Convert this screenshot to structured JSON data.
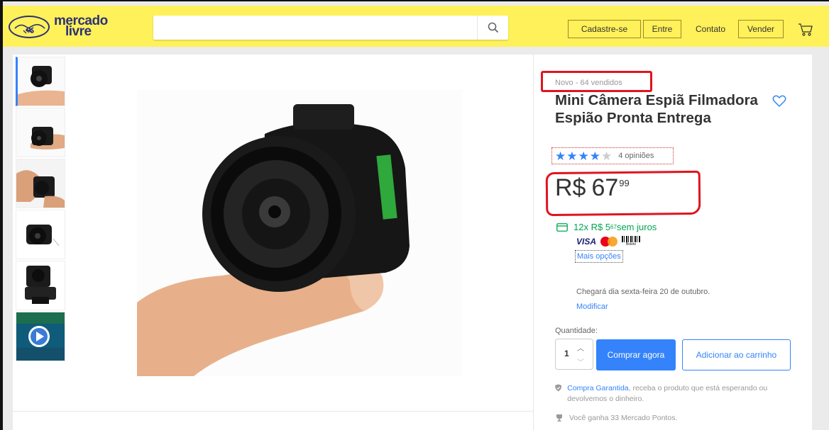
{
  "header": {
    "logo_line1": "mercado",
    "logo_line2": "livre",
    "search": {
      "value": "",
      "placeholder": ""
    },
    "nav": {
      "signup": "Cadastre-se",
      "login": "Entre",
      "contact": "Contato",
      "sell": "Vender"
    }
  },
  "product": {
    "condition": "Novo  -  64 vendidos",
    "title": "Mini Câmera Espiã Filmadora Espião Pronta Entrega",
    "rating": {
      "stars": 4,
      "max": 5,
      "reviews_label": "4 opiniões"
    },
    "price": {
      "currency": "R$",
      "integer": "67",
      "cents": "99"
    },
    "installments": {
      "prefix": "12x R$ 5",
      "cents": "67",
      "suffix": " sem juros"
    },
    "payment": {
      "visa": "VISA",
      "boleto": "Boleto",
      "more": "Mais opções"
    },
    "delivery": "Chegará dia sexta-feira 20 de outubro.",
    "modify": "Modificar",
    "quantity_label": "Quantidade:",
    "quantity": "1",
    "buy_now": "Comprar agora",
    "add_to_cart": "Adicionar ao carrinho",
    "guarantee": {
      "link": "Compra Garantida",
      "text": ", receba o produto que está esperando ou devolvemos o dinheiro."
    },
    "points": "Você ganha 33 Mercado Pontos."
  },
  "thumbnails": [
    {
      "icon": "camera-photo"
    },
    {
      "icon": "camera-photo"
    },
    {
      "icon": "camera-photo"
    },
    {
      "icon": "camera-photo"
    },
    {
      "icon": "camera-photo"
    },
    {
      "icon": "video-play"
    }
  ],
  "colors": {
    "header_bg": "#fff159",
    "accent": "#3483fa",
    "green": "#00a650",
    "annotation_red": "#e0141e"
  }
}
